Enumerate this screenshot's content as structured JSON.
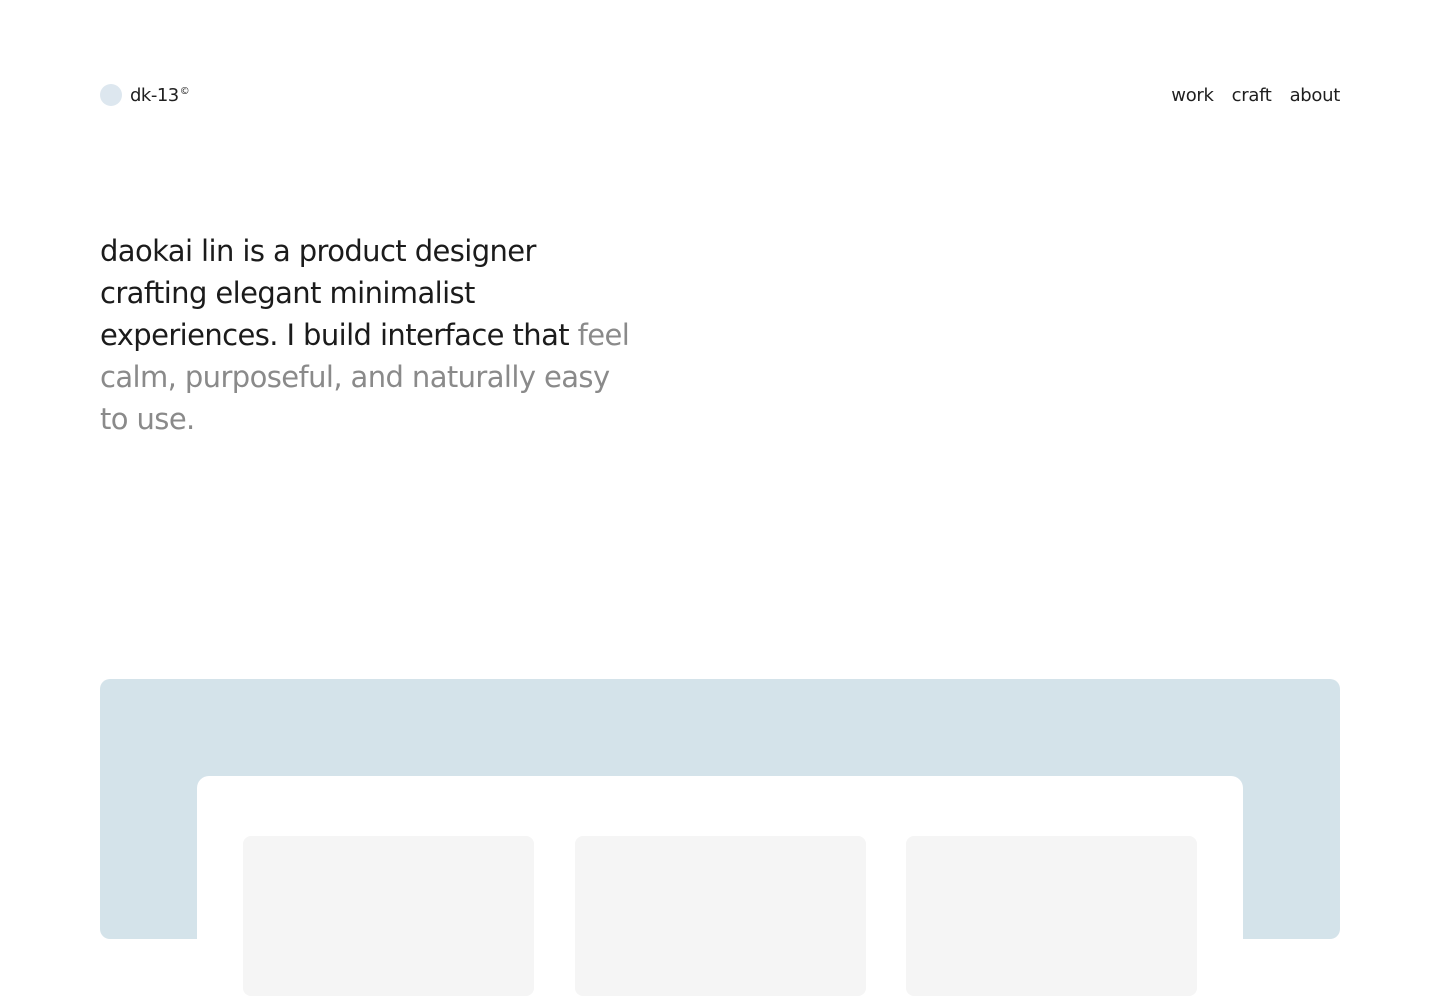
{
  "brand": {
    "name": "dk-13",
    "mark": "©",
    "dot_color": "#dde7ef"
  },
  "nav": {
    "items": [
      {
        "label": "work"
      },
      {
        "label": "craft"
      },
      {
        "label": "about"
      }
    ]
  },
  "intro": {
    "lead": "daokai lin is a product designer crafting elegant minimalist experiences. I build interface that ",
    "muted": "feel calm, purposeful, and naturally easy to use."
  },
  "colors": {
    "text": "#1b1b1b",
    "muted_text": "#8a8a8a",
    "showcase_bg": "#d4e3ea",
    "card_bg": "#ffffff",
    "tile_bg": "#f5f5f5"
  }
}
